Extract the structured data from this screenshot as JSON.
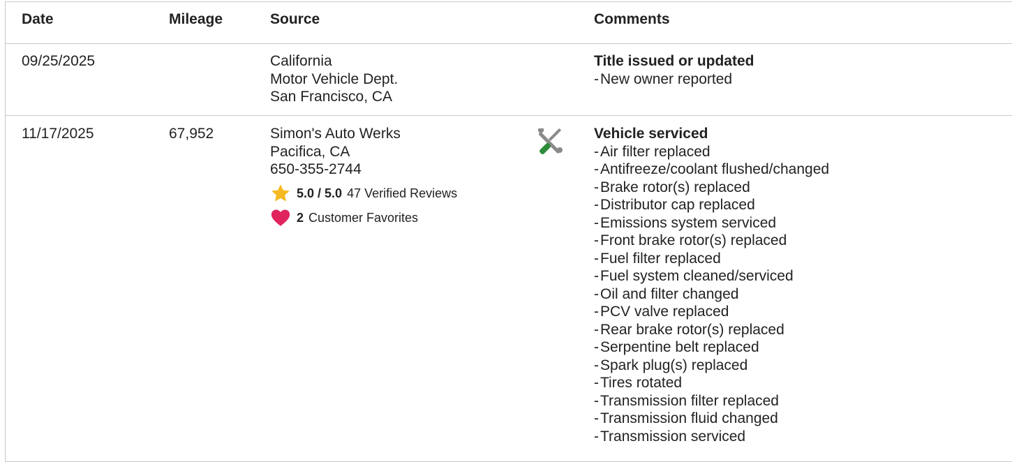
{
  "headers": {
    "date": "Date",
    "mileage": "Mileage",
    "source": "Source",
    "comments": "Comments"
  },
  "rows": [
    {
      "date": "09/25/2025",
      "mileage": "",
      "source_lines": [
        "California",
        "Motor Vehicle Dept.",
        "San Francisco, CA"
      ],
      "comment_title": "Title issued or updated",
      "comment_items": [
        "New owner reported"
      ]
    },
    {
      "date": "11/17/2025",
      "mileage": "67,952",
      "source_lines": [
        "Simon's Auto Werks",
        "Pacifica, CA",
        "650-355-2744"
      ],
      "rating": {
        "score": "5.0 / 5.0",
        "reviews": "47 Verified Reviews",
        "favorites_count": "2",
        "favorites_label": "Customer Favorites"
      },
      "service_icon": "service-wrench-screwdriver-icon",
      "comment_title": "Vehicle serviced",
      "comment_items": [
        "Air filter replaced",
        "Antifreeze/coolant flushed/changed",
        "Brake rotor(s) replaced",
        "Distributor cap replaced",
        "Emissions system serviced",
        "Front brake rotor(s) replaced",
        "Fuel filter replaced",
        "Fuel system cleaned/serviced",
        "Oil and filter changed",
        "PCV valve replaced",
        "Rear brake rotor(s) replaced",
        "Serpentine belt replaced",
        "Spark plug(s) replaced",
        "Tires rotated",
        "Transmission filter replaced",
        "Transmission fluid changed",
        "Transmission serviced"
      ]
    }
  ],
  "colors": {
    "star": "#f5b921",
    "heart": "#e0245e",
    "tool_green": "#2e8b3a",
    "tool_gray": "#8a8a8a",
    "border": "#c8c8c8"
  }
}
